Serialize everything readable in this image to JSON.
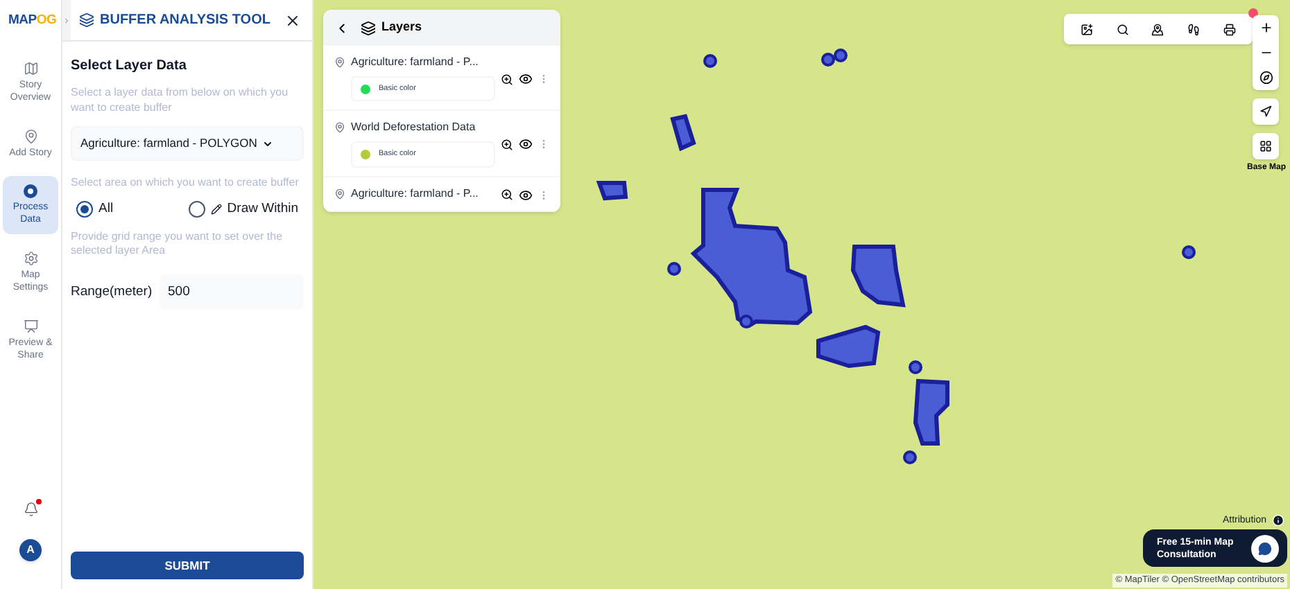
{
  "logo": {
    "text_a": "MAP",
    "text_b": "OG"
  },
  "nav": [
    {
      "label": "Story Overview",
      "selected": false
    },
    {
      "label": "Add Story",
      "selected": false
    },
    {
      "label": "Process Data",
      "selected": true
    },
    {
      "label": "Map Settings",
      "selected": false
    },
    {
      "label": "Preview & Share",
      "selected": false
    }
  ],
  "notifications": {
    "unread": true
  },
  "avatar": {
    "initial": "A"
  },
  "tool": {
    "title": "BUFFER ANALYSIS TOOL",
    "section": "Select Layer Data",
    "layer_hint": "Select a layer data from below on which you want to create buffer",
    "layer_select": "Agriculture: farmland - POLYGON",
    "area_hint": "Select area on which you want to create buffer",
    "area_options": [
      {
        "label": "All",
        "selected": true,
        "kind": "all"
      },
      {
        "label": "Draw Within",
        "selected": false,
        "kind": "draw"
      }
    ],
    "grid_hint": "Provide grid range you want to set over the selected layer Area",
    "range_label": "Range(meter)",
    "range_value": "500",
    "submit": "SUBMIT"
  },
  "layers_panel": {
    "title": "Layers",
    "layers": [
      {
        "name": "Agriculture: farmland - P...",
        "style": "Basic color",
        "color": "#22dd55"
      },
      {
        "name": "World Deforestation Data",
        "style": "Basic color",
        "color": "#b5c93a"
      },
      {
        "name": "Agriculture: farmland - P..."
      }
    ]
  },
  "toolbar": {
    "close_badge": true
  },
  "base_map_label": "Base Map",
  "attribution": "Attribution",
  "consultation": "Free 15-min Map Consultation",
  "credits": "© MapTiler © OpenStreetMap contributors"
}
